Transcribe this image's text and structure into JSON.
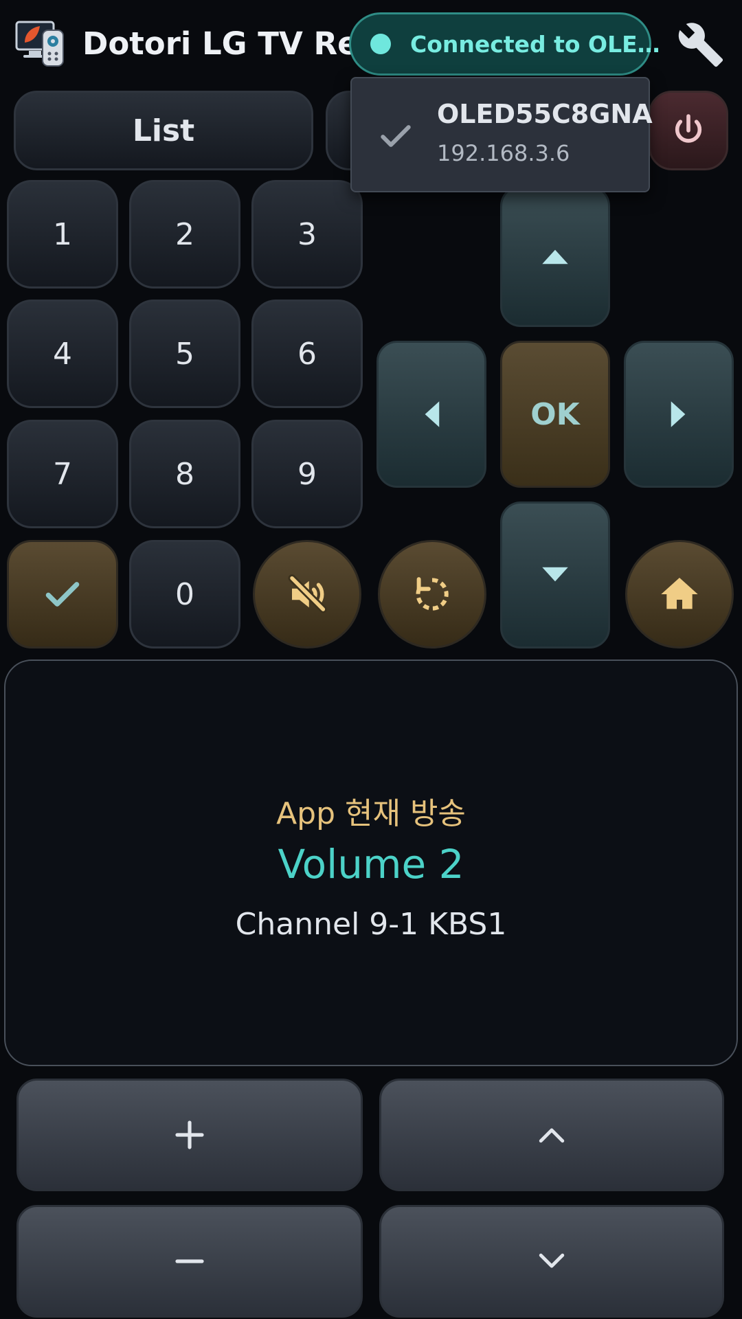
{
  "app": {
    "title": "Dotori LG TV Re…"
  },
  "connection": {
    "status": "Connected to OLE…"
  },
  "toolbar": {
    "list_label": "List"
  },
  "device_menu": {
    "items": [
      {
        "name": "OLED55C8GNA",
        "ip": "192.168.3.6",
        "selected": true
      }
    ]
  },
  "numpad": {
    "keys": [
      "1",
      "2",
      "3",
      "4",
      "5",
      "6",
      "7",
      "8",
      "9",
      "0"
    ]
  },
  "dpad": {
    "ok_label": "OK"
  },
  "info": {
    "app_line": "App 현재 방송",
    "volume_line": "Volume 2",
    "channel_line": "Channel 9-1 KBS1"
  },
  "colors": {
    "accent_teal": "#4cd2c8",
    "accent_gold": "#e6c27c",
    "power_red": "#f0c7cc"
  },
  "icons": {
    "settings": "wrench-icon",
    "power": "power-icon",
    "confirm": "check-icon",
    "mute": "volume-mute-icon",
    "replay": "replay-icon",
    "home": "home-icon",
    "volume_up": "plus-icon",
    "volume_down": "minus-icon",
    "channel_up": "chevron-up-icon",
    "channel_down": "chevron-down-icon"
  }
}
